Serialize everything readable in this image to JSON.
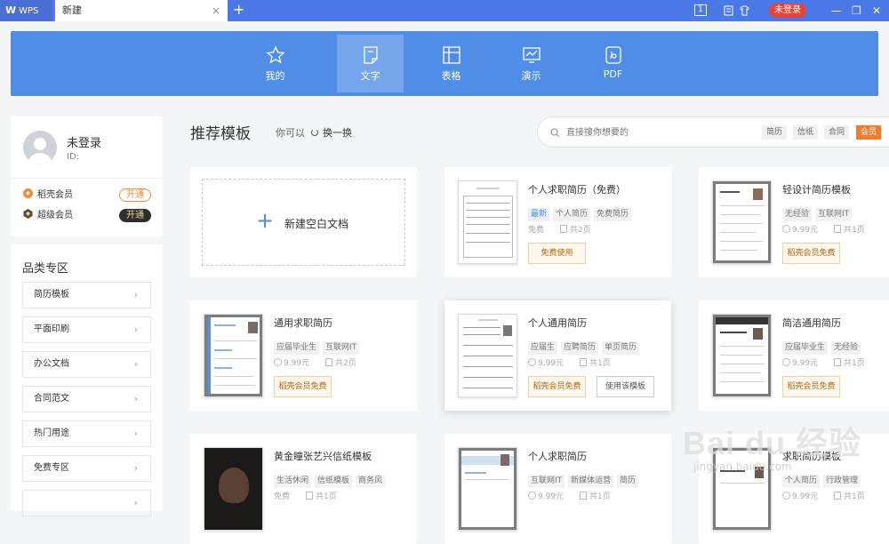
{
  "titlebar": {
    "app_name": "WPS",
    "tab_label": "新建",
    "close_glyph": "×",
    "add_glyph": "+",
    "page_count": "1",
    "login_label": "未登录",
    "minimize_glyph": "—",
    "restore_glyph": "❐",
    "close_window_glyph": "✕"
  },
  "nav": {
    "items": [
      {
        "label": "我的",
        "icon": "star-icon"
      },
      {
        "label": "文字",
        "icon": "document-icon",
        "active": true
      },
      {
        "label": "表格",
        "icon": "table-icon"
      },
      {
        "label": "演示",
        "icon": "presentation-icon"
      },
      {
        "label": "PDF",
        "icon": "pdf-icon"
      }
    ]
  },
  "user": {
    "name": "未登录",
    "id_label": "ID:",
    "vip1_label": "稻壳会员",
    "vip1_button": "开通",
    "vip2_label": "超级会员",
    "vip2_button": "开通"
  },
  "categories": {
    "title": "品类专区",
    "items": [
      "简历模板",
      "平面印刷",
      "办公文档",
      "合同范文",
      "热门用途",
      "免费专区"
    ]
  },
  "main": {
    "title": "推荐模板",
    "you_can": "你可以",
    "refresh_label": "换一换",
    "search_placeholder": "直接搜你想要的",
    "search_tags": [
      "简历",
      "信纸",
      "合同",
      "会员"
    ],
    "new_doc_label": "新建空白文档"
  },
  "templates": [
    {
      "title": "个人求职简历（免费）",
      "tags": [
        "最新",
        "个人简历",
        "免费简历"
      ],
      "price": "免费",
      "pages": "共2页",
      "button": "免费使用"
    },
    {
      "title": "轻设计简历模板",
      "tags": [
        "无经验",
        "互联网IT"
      ],
      "price": "9.99元",
      "pages": "共1页",
      "button": "稻壳会员免费"
    },
    {
      "title": "通用求职简历",
      "tags": [
        "应届毕业生",
        "互联网IT"
      ],
      "price": "9.99元",
      "pages": "共2页",
      "button": "稻壳会员免费"
    },
    {
      "title": "个人通用简历",
      "tags": [
        "应届生",
        "应聘简历",
        "单页简历"
      ],
      "price": "9.99元",
      "pages": "共1页",
      "button": "稻壳会员免费",
      "button2": "使用该模板"
    },
    {
      "title": "简洁通用简历",
      "tags": [
        "应届毕业生",
        "无经验"
      ],
      "price": "9.99元",
      "pages": "共1页",
      "button": "稻壳会员免费"
    },
    {
      "title": "黄金瞳张艺兴信纸模板",
      "tags": [
        "生活休闲",
        "信纸模板",
        "商务风"
      ],
      "price": "免费",
      "pages": "共1页"
    },
    {
      "title": "个人求职简历",
      "tags": [
        "互联网IT",
        "新媒体运营",
        "简历"
      ],
      "price": "9.99元",
      "pages": "共1页"
    },
    {
      "title": "求职简历模板",
      "tags": [
        "个人简历",
        "行政管理"
      ],
      "price": "9.99元",
      "pages": "共1页"
    }
  ],
  "watermark": {
    "big": "Bai du 经验",
    "small": "jingyan.baidu.com"
  },
  "colors": {
    "accent": "#4f8de6",
    "titlebar": "#4a78e6",
    "vip_orange": "#f37b2d",
    "login_red": "#e6433b"
  }
}
